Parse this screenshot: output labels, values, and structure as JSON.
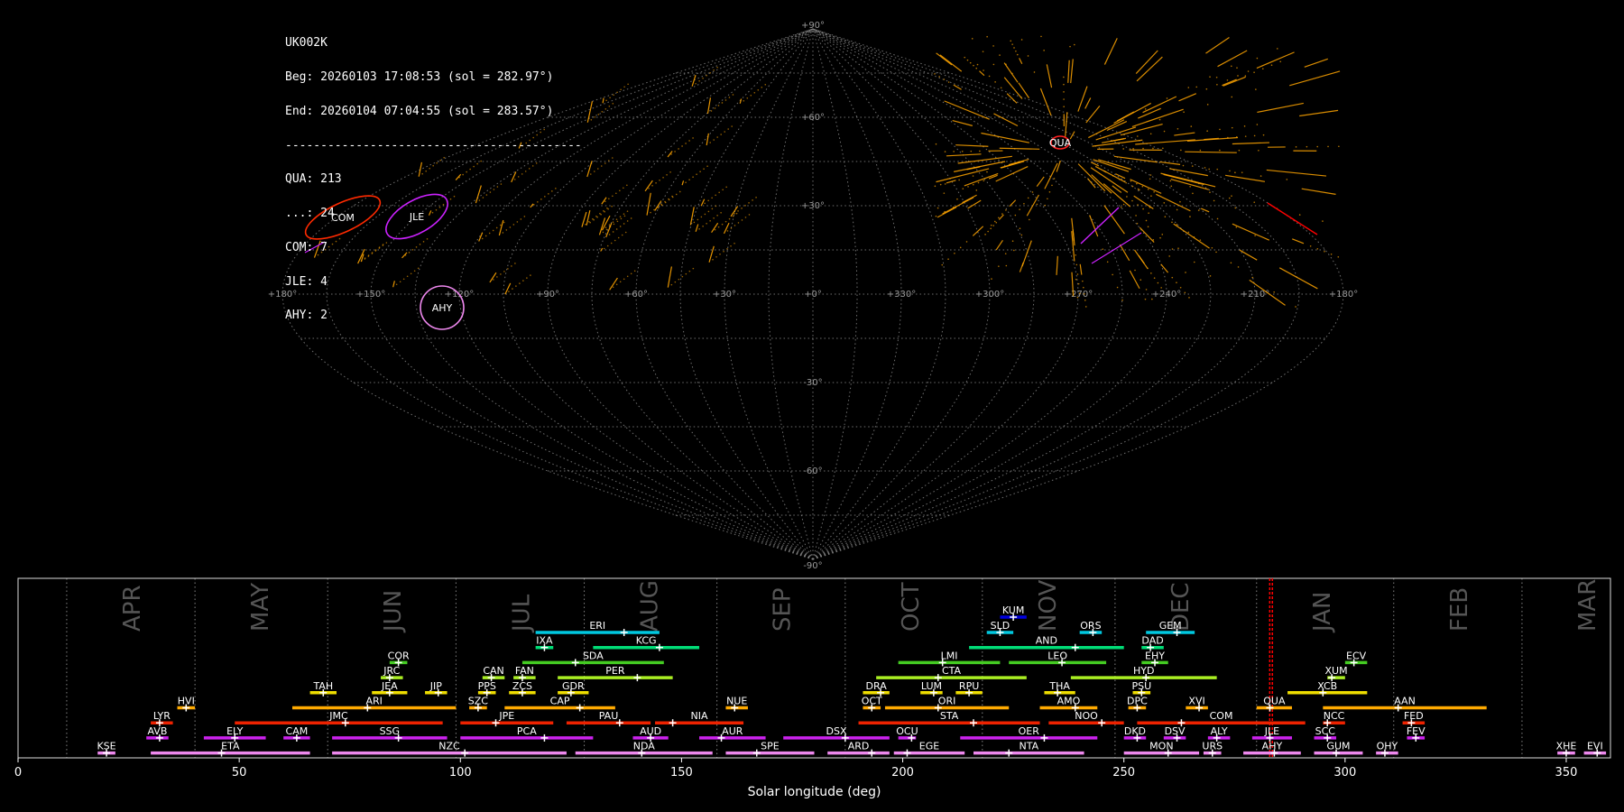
{
  "info": {
    "station": "UK002K",
    "begin": "Beg: 20260103 17:08:53 (sol = 282.97°)",
    "end": "End: 20260104 07:04:55 (sol = 283.57°)",
    "separator": "------------------------------------------",
    "counts": [
      "QUA: 213",
      "...: 24",
      "COM: 7",
      "JLE: 4",
      "AHY: 2"
    ]
  },
  "colors": {
    "background": "#000000",
    "grid": "#8a8a8a",
    "meteor_sporadic": "#ffa500",
    "qua": "#ff0000",
    "com": "#ff2a00",
    "jle": "#cc22ff",
    "ahy": "#ee88ee",
    "current_sol": "#ff0000"
  },
  "sky_map": {
    "projection": "sinusoidal",
    "lon_labels": [
      "+180°",
      "+150°",
      "+120°",
      "+90°",
      "+60°",
      "+30°",
      "+0°",
      "+330°",
      "+300°",
      "+270°",
      "+240°",
      "+210°",
      "+180°"
    ],
    "lat_labels": [
      "+90°",
      "+60°",
      "+30°",
      "-30°",
      "-60°",
      "-90°"
    ],
    "radiants": [
      {
        "code": "QUA",
        "ra": 230,
        "dec": 49,
        "color": "#ff2020"
      },
      {
        "code": "COM",
        "ra": 163,
        "dec": 25,
        "color": "#ff2a00"
      },
      {
        "code": "JLE",
        "ra": 150,
        "dec": 24,
        "color": "#cc22ff"
      },
      {
        "code": "AHY",
        "ra": 136,
        "dec": -3,
        "color": "#ee88ee"
      }
    ]
  },
  "chart_data": {
    "type": "bar",
    "xlabel": "Solar longitude (deg)",
    "xlim": [
      0,
      360
    ],
    "xticks": [
      0,
      50,
      100,
      150,
      200,
      250,
      300,
      350
    ],
    "current_sol": [
      282.97,
      283.57
    ],
    "months": [
      {
        "name": "APR",
        "start": 11
      },
      {
        "name": "MAY",
        "start": 40
      },
      {
        "name": "JUN",
        "start": 70
      },
      {
        "name": "JUL",
        "start": 99
      },
      {
        "name": "AUG",
        "start": 128
      },
      {
        "name": "SEP",
        "start": 158
      },
      {
        "name": "OCT",
        "start": 187
      },
      {
        "name": "NOV",
        "start": 218
      },
      {
        "name": "DEC",
        "start": 248
      },
      {
        "name": "JAN",
        "start": 280
      },
      {
        "name": "FEB",
        "start": 311
      },
      {
        "name": "MAR",
        "start": 340
      }
    ],
    "showers": [
      {
        "code": "KUM",
        "start": 222,
        "end": 228,
        "peak": 225,
        "row": 0,
        "color": "#0000dd"
      },
      {
        "code": "ERI",
        "start": 117,
        "end": 145,
        "peak": 137,
        "row": 1,
        "color": "#00c8e0"
      },
      {
        "code": "SLD",
        "start": 219,
        "end": 225,
        "peak": 222,
        "row": 1,
        "color": "#00c8e0"
      },
      {
        "code": "ORS",
        "start": 240,
        "end": 245,
        "peak": 243,
        "row": 1,
        "color": "#00c8e0"
      },
      {
        "code": "GEM",
        "start": 255,
        "end": 266,
        "peak": 262,
        "row": 1,
        "color": "#00c8e0"
      },
      {
        "code": "IXA",
        "start": 117,
        "end": 121,
        "peak": 119,
        "row": 2,
        "color": "#00dd77"
      },
      {
        "code": "KCG",
        "start": 130,
        "end": 154,
        "peak": 145,
        "row": 2,
        "color": "#00dd77"
      },
      {
        "code": "AND",
        "start": 215,
        "end": 250,
        "peak": 239,
        "row": 2,
        "color": "#00dd77"
      },
      {
        "code": "DAD",
        "start": 254,
        "end": 259,
        "peak": 256,
        "row": 2,
        "color": "#00dd77"
      },
      {
        "code": "COR",
        "start": 84,
        "end": 88,
        "peak": 86,
        "row": 3,
        "color": "#44cc22"
      },
      {
        "code": "SDA",
        "start": 114,
        "end": 146,
        "peak": 126,
        "row": 3,
        "color": "#44cc22"
      },
      {
        "code": "LMI",
        "start": 199,
        "end": 222,
        "peak": 209,
        "row": 3,
        "color": "#44cc22"
      },
      {
        "code": "LEO",
        "start": 224,
        "end": 246,
        "peak": 236,
        "row": 3,
        "color": "#44cc22"
      },
      {
        "code": "EHY",
        "start": 254,
        "end": 260,
        "peak": 257,
        "row": 3,
        "color": "#44cc22"
      },
      {
        "code": "ECV",
        "start": 300,
        "end": 305,
        "peak": 302,
        "row": 3,
        "color": "#44cc22"
      },
      {
        "code": "JRC",
        "start": 82,
        "end": 87,
        "peak": 84,
        "row": 4,
        "color": "#aaee22"
      },
      {
        "code": "CAN",
        "start": 105,
        "end": 110,
        "peak": 107,
        "row": 4,
        "color": "#aaee22"
      },
      {
        "code": "FAN",
        "start": 112,
        "end": 117,
        "peak": 114,
        "row": 4,
        "color": "#aaee22"
      },
      {
        "code": "PER",
        "start": 122,
        "end": 148,
        "peak": 140,
        "row": 4,
        "color": "#aaee22"
      },
      {
        "code": "CTA",
        "start": 194,
        "end": 228,
        "peak": 208,
        "row": 4,
        "color": "#aaee22"
      },
      {
        "code": "HYD",
        "start": 238,
        "end": 271,
        "peak": 255,
        "row": 4,
        "color": "#aaee22"
      },
      {
        "code": "XUM",
        "start": 296,
        "end": 300,
        "peak": 297,
        "row": 4,
        "color": "#aaee22"
      },
      {
        "code": "TAH",
        "start": 66,
        "end": 72,
        "peak": 69,
        "row": 5,
        "color": "#eedd00"
      },
      {
        "code": "JEA",
        "start": 80,
        "end": 88,
        "peak": 84,
        "row": 5,
        "color": "#eedd00"
      },
      {
        "code": "JIP",
        "start": 92,
        "end": 97,
        "peak": 95,
        "row": 5,
        "color": "#eedd00"
      },
      {
        "code": "PPS",
        "start": 104,
        "end": 108,
        "peak": 106,
        "row": 5,
        "color": "#eedd00"
      },
      {
        "code": "ZCS",
        "start": 111,
        "end": 117,
        "peak": 114,
        "row": 5,
        "color": "#eedd00"
      },
      {
        "code": "GDR",
        "start": 122,
        "end": 129,
        "peak": 125,
        "row": 5,
        "color": "#eedd00"
      },
      {
        "code": "DRA",
        "start": 191,
        "end": 197,
        "peak": 195,
        "row": 5,
        "color": "#eedd00"
      },
      {
        "code": "LUM",
        "start": 204,
        "end": 209,
        "peak": 207,
        "row": 5,
        "color": "#eedd00"
      },
      {
        "code": "RPU",
        "start": 212,
        "end": 218,
        "peak": 215,
        "row": 5,
        "color": "#eedd00"
      },
      {
        "code": "THA",
        "start": 232,
        "end": 239,
        "peak": 235,
        "row": 5,
        "color": "#eedd00"
      },
      {
        "code": "PSU",
        "start": 252,
        "end": 256,
        "peak": 254,
        "row": 5,
        "color": "#eedd00"
      },
      {
        "code": "XCB",
        "start": 287,
        "end": 305,
        "peak": 295,
        "row": 5,
        "color": "#eedd00"
      },
      {
        "code": "HVI",
        "start": 36,
        "end": 40,
        "peak": 38,
        "row": 6,
        "color": "#ffaa00"
      },
      {
        "code": "ARI",
        "start": 62,
        "end": 99,
        "peak": 79,
        "row": 6,
        "color": "#ffaa00"
      },
      {
        "code": "SZC",
        "start": 102,
        "end": 106,
        "peak": 104,
        "row": 6,
        "color": "#ffaa00"
      },
      {
        "code": "CAP",
        "start": 110,
        "end": 135,
        "peak": 127,
        "row": 6,
        "color": "#ffaa00"
      },
      {
        "code": "NUE",
        "start": 160,
        "end": 165,
        "peak": 162,
        "row": 6,
        "color": "#ffaa00"
      },
      {
        "code": "OCT",
        "start": 191,
        "end": 195,
        "peak": 193,
        "row": 6,
        "color": "#ffaa00"
      },
      {
        "code": "ORI",
        "start": 196,
        "end": 224,
        "peak": 208,
        "row": 6,
        "color": "#ffaa00"
      },
      {
        "code": "AMO",
        "start": 231,
        "end": 244,
        "peak": 239,
        "row": 6,
        "color": "#ffaa00"
      },
      {
        "code": "DPC",
        "start": 251,
        "end": 255,
        "peak": 253,
        "row": 6,
        "color": "#ffaa00"
      },
      {
        "code": "XVI",
        "start": 264,
        "end": 269,
        "peak": 267,
        "row": 6,
        "color": "#ffaa00"
      },
      {
        "code": "QUA",
        "start": 280,
        "end": 288,
        "peak": 283,
        "row": 6,
        "color": "#ffaa00"
      },
      {
        "code": "AAN",
        "start": 295,
        "end": 332,
        "peak": 312,
        "row": 6,
        "color": "#ffaa00"
      },
      {
        "code": "LYR",
        "start": 30,
        "end": 35,
        "peak": 32,
        "row": 7,
        "color": "#ee2200"
      },
      {
        "code": "JMC",
        "start": 49,
        "end": 96,
        "peak": 74,
        "row": 7,
        "color": "#ee2200"
      },
      {
        "code": "JPE",
        "start": 100,
        "end": 121,
        "peak": 108,
        "row": 7,
        "color": "#ee2200"
      },
      {
        "code": "PAU",
        "start": 124,
        "end": 143,
        "peak": 136,
        "row": 7,
        "color": "#ee2200"
      },
      {
        "code": "NIA",
        "start": 144,
        "end": 164,
        "peak": 148,
        "row": 7,
        "color": "#ee2200"
      },
      {
        "code": "STA",
        "start": 190,
        "end": 231,
        "peak": 216,
        "row": 7,
        "color": "#ee2200"
      },
      {
        "code": "NOO",
        "start": 233,
        "end": 250,
        "peak": 245,
        "row": 7,
        "color": "#ee2200"
      },
      {
        "code": "COM",
        "start": 253,
        "end": 291,
        "peak": 263,
        "row": 7,
        "color": "#ee2200"
      },
      {
        "code": "NCC",
        "start": 295,
        "end": 300,
        "peak": 296,
        "row": 7,
        "color": "#ee2200"
      },
      {
        "code": "FED",
        "start": 313,
        "end": 318,
        "peak": 315,
        "row": 7,
        "color": "#ee2200"
      },
      {
        "code": "AVB",
        "start": 29,
        "end": 34,
        "peak": 32,
        "row": 8,
        "color": "#cc22ee"
      },
      {
        "code": "ELY",
        "start": 42,
        "end": 56,
        "peak": 49,
        "row": 8,
        "color": "#cc22ee"
      },
      {
        "code": "CAM",
        "start": 60,
        "end": 66,
        "peak": 63,
        "row": 8,
        "color": "#cc22ee"
      },
      {
        "code": "SSG",
        "start": 71,
        "end": 97,
        "peak": 86,
        "row": 8,
        "color": "#cc22ee"
      },
      {
        "code": "PCA",
        "start": 100,
        "end": 130,
        "peak": 119,
        "row": 8,
        "color": "#cc22ee"
      },
      {
        "code": "AUD",
        "start": 139,
        "end": 147,
        "peak": 143,
        "row": 8,
        "color": "#cc22ee"
      },
      {
        "code": "AUR",
        "start": 154,
        "end": 169,
        "peak": 159,
        "row": 8,
        "color": "#cc22ee"
      },
      {
        "code": "DSX",
        "start": 173,
        "end": 197,
        "peak": 187,
        "row": 8,
        "color": "#cc22ee"
      },
      {
        "code": "OCU",
        "start": 199,
        "end": 203,
        "peak": 202,
        "row": 8,
        "color": "#cc22ee"
      },
      {
        "code": "OER",
        "start": 213,
        "end": 244,
        "peak": 232,
        "row": 8,
        "color": "#cc22ee"
      },
      {
        "code": "DKD",
        "start": 250,
        "end": 255,
        "peak": 253,
        "row": 8,
        "color": "#cc22ee"
      },
      {
        "code": "DSV",
        "start": 259,
        "end": 264,
        "peak": 262,
        "row": 8,
        "color": "#cc22ee"
      },
      {
        "code": "ALY",
        "start": 269,
        "end": 274,
        "peak": 271,
        "row": 8,
        "color": "#cc22ee"
      },
      {
        "code": "JLE",
        "start": 279,
        "end": 288,
        "peak": 283,
        "row": 8,
        "color": "#cc22ee"
      },
      {
        "code": "SCC",
        "start": 293,
        "end": 298,
        "peak": 296,
        "row": 8,
        "color": "#cc22ee"
      },
      {
        "code": "FEV",
        "start": 314,
        "end": 318,
        "peak": 316,
        "row": 8,
        "color": "#cc22ee"
      },
      {
        "code": "KSE",
        "start": 18,
        "end": 22,
        "peak": 20,
        "row": 9,
        "color": "#ee88ee"
      },
      {
        "code": "ETA",
        "start": 30,
        "end": 66,
        "peak": 46,
        "row": 9,
        "color": "#ee88ee"
      },
      {
        "code": "NZC",
        "start": 71,
        "end": 124,
        "peak": 101,
        "row": 9,
        "color": "#ee88ee"
      },
      {
        "code": "NDA",
        "start": 126,
        "end": 157,
        "peak": 141,
        "row": 9,
        "color": "#ee88ee"
      },
      {
        "code": "SPE",
        "start": 160,
        "end": 180,
        "peak": 167,
        "row": 9,
        "color": "#ee88ee"
      },
      {
        "code": "ARD",
        "start": 183,
        "end": 197,
        "peak": 193,
        "row": 9,
        "color": "#ee88ee"
      },
      {
        "code": "EGE",
        "start": 198,
        "end": 214,
        "peak": 201,
        "row": 9,
        "color": "#ee88ee"
      },
      {
        "code": "NTA",
        "start": 216,
        "end": 241,
        "peak": 224,
        "row": 9,
        "color": "#ee88ee"
      },
      {
        "code": "MON",
        "start": 250,
        "end": 267,
        "peak": 260,
        "row": 9,
        "color": "#ee88ee"
      },
      {
        "code": "URS",
        "start": 268,
        "end": 272,
        "peak": 270,
        "row": 9,
        "color": "#ee88ee"
      },
      {
        "code": "AHY",
        "start": 277,
        "end": 290,
        "peak": 284,
        "row": 9,
        "color": "#ee88ee"
      },
      {
        "code": "GUM",
        "start": 293,
        "end": 304,
        "peak": 298,
        "row": 9,
        "color": "#ee88ee"
      },
      {
        "code": "OHY",
        "start": 307,
        "end": 312,
        "peak": 309,
        "row": 9,
        "color": "#ee88ee"
      },
      {
        "code": "XHE",
        "start": 348,
        "end": 352,
        "peak": 350,
        "row": 9,
        "color": "#ee88ee"
      },
      {
        "code": "EVI",
        "start": 354,
        "end": 359,
        "peak": 357,
        "row": 9,
        "color": "#ee88ee"
      }
    ]
  }
}
